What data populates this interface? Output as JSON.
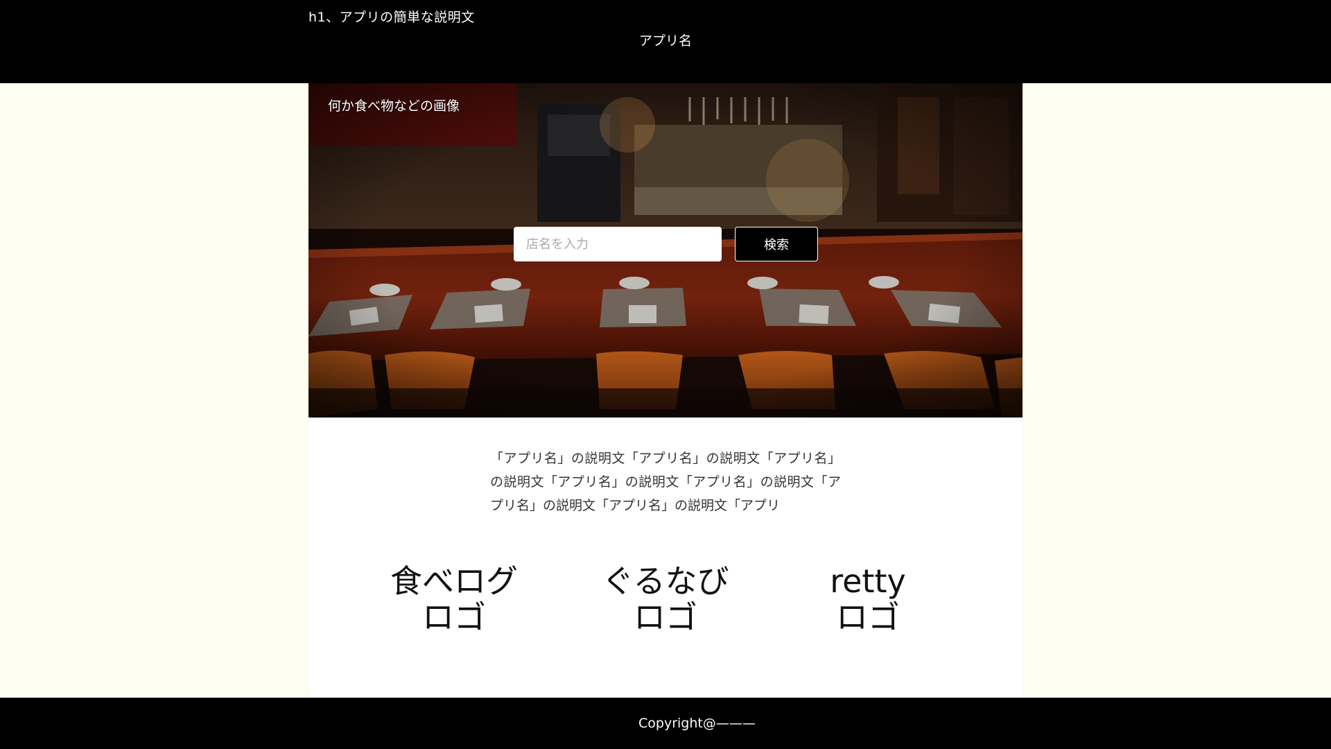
{
  "header": {
    "tagline": "h1、アプリの簡単な説明文",
    "app_name": "アプリ名"
  },
  "hero": {
    "caption": "何か食べ物などの画像",
    "search_placeholder": "店名を入力",
    "search_button_label": "検索"
  },
  "description": {
    "text": "「アプリ名」の説明文「アプリ名」の説明文「アプリ名」の説明文「アプリ名」の説明文「アプリ名」の説明文「アプリ名」の説明文「アプリ名」の説明文「アプリ"
  },
  "logos": [
    {
      "line1": "食べログ",
      "line2": "ロゴ"
    },
    {
      "line1": "ぐるなび",
      "line2": "ロゴ"
    },
    {
      "line1": "retty",
      "line2": "ロゴ"
    }
  ],
  "footer": {
    "copyright": "Copyright@———"
  },
  "colors": {
    "page_background": "#fefff0",
    "header_footer": "#000000",
    "content_panel": "#ffffff"
  }
}
